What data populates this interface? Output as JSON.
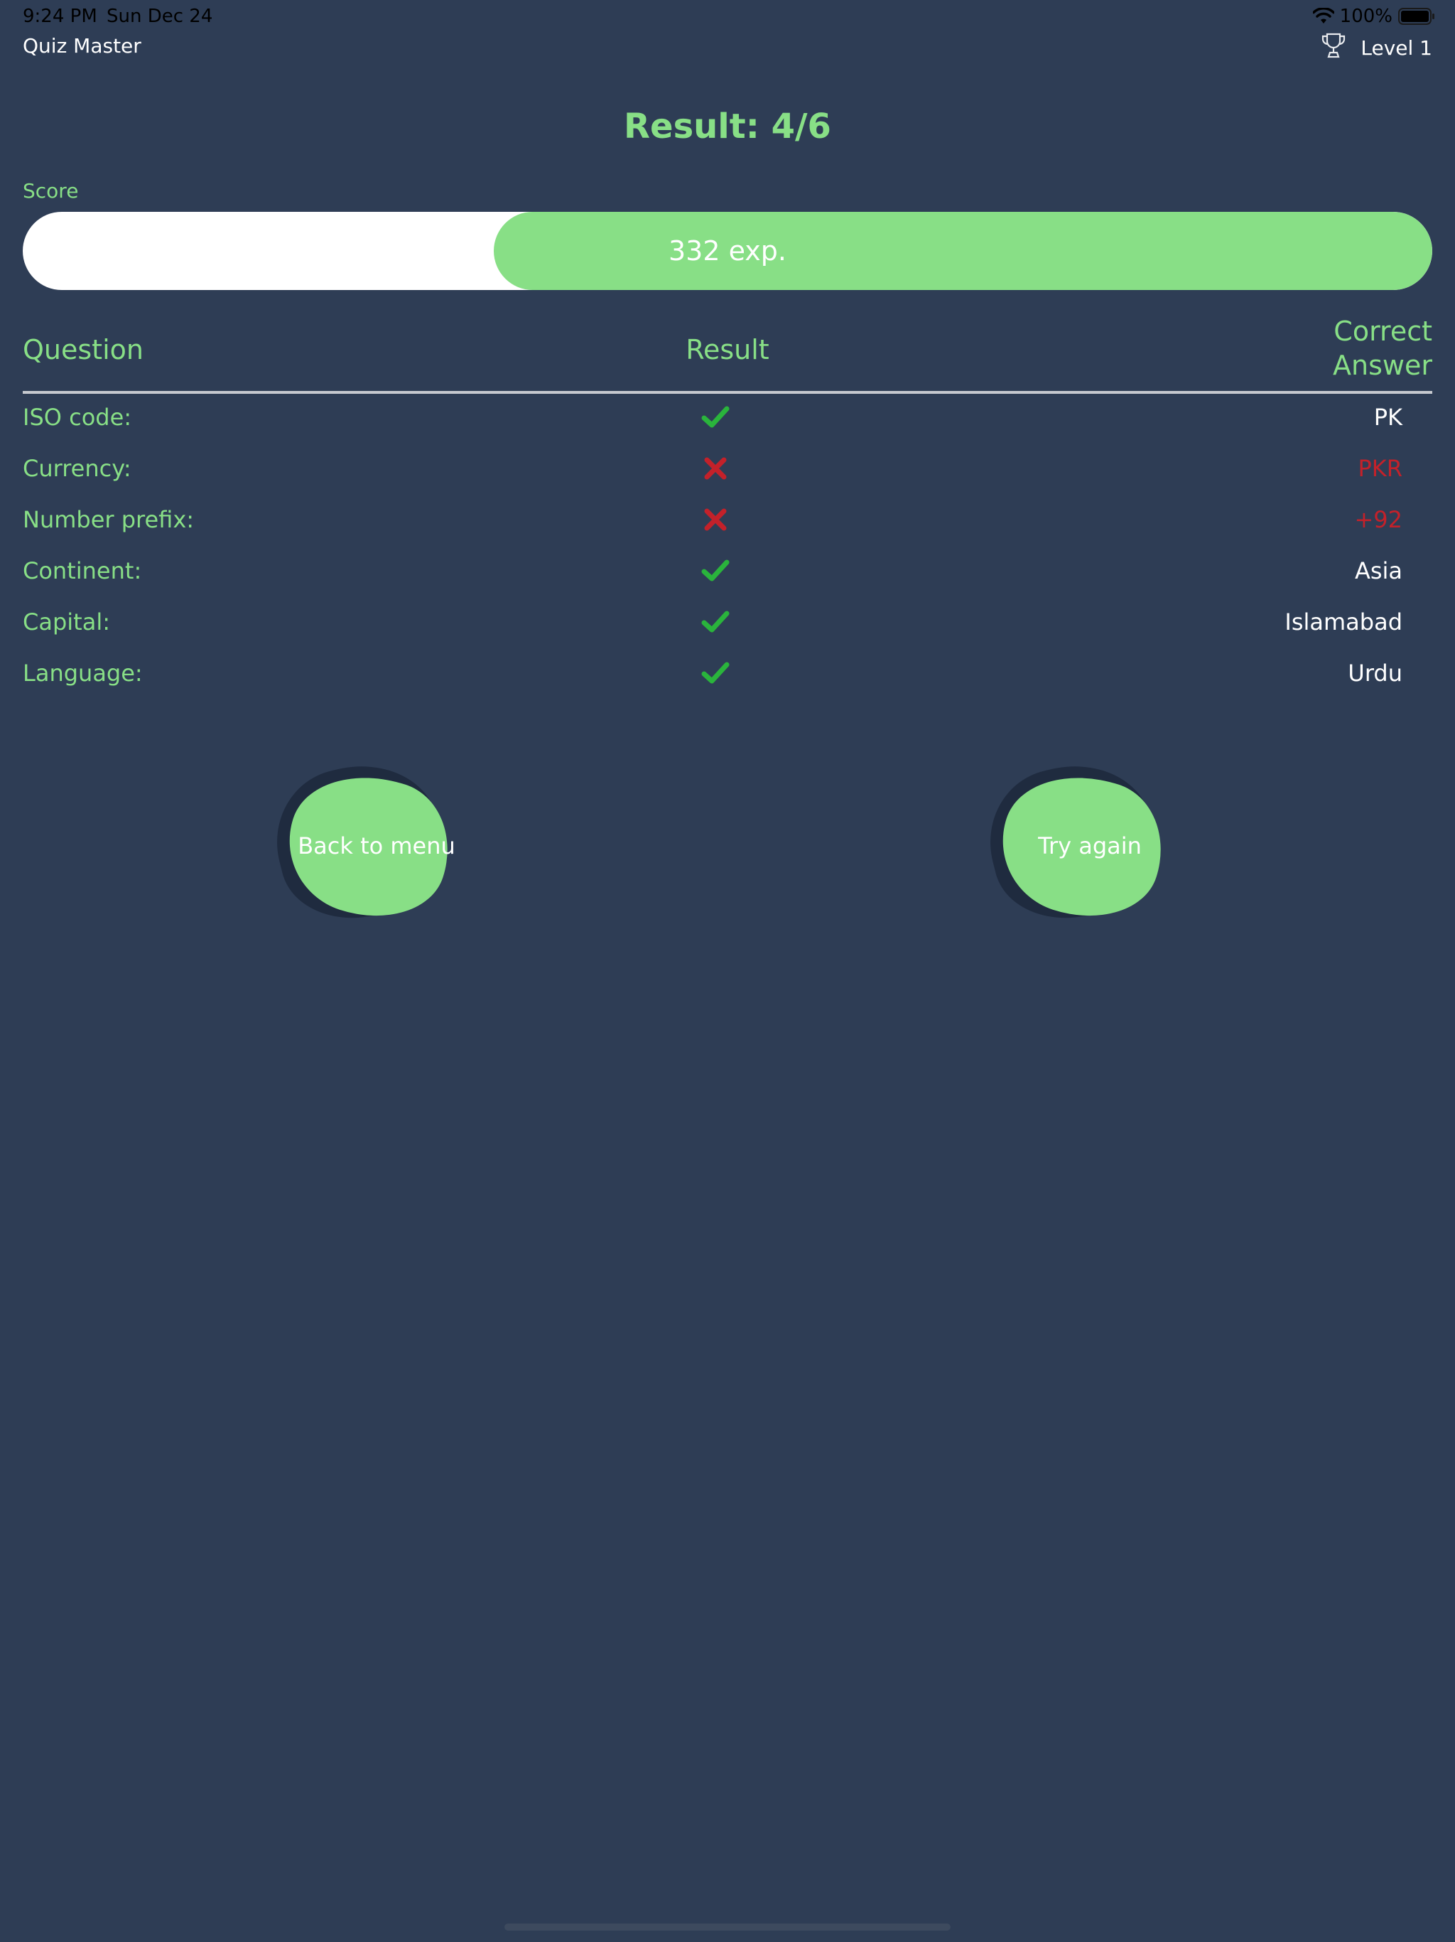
{
  "status_bar": {
    "time": "9:24 PM",
    "date": "Sun Dec 24",
    "battery": "100%"
  },
  "header": {
    "app_title": "Quiz Master",
    "level": "Level 1",
    "level_icon": "trophy-icon"
  },
  "result": {
    "title": "Result: 4/6"
  },
  "score": {
    "label": "Score",
    "value_text": "332 exp.",
    "progress_fraction": 0.666
  },
  "table": {
    "headers": {
      "question": "Question",
      "result": "Result",
      "correct_answer_line1": "Correct",
      "correct_answer_line2": "Answer"
    },
    "rows": [
      {
        "question": "ISO code:",
        "correct": true,
        "answer": "PK"
      },
      {
        "question": "Currency:",
        "correct": false,
        "answer": "PKR"
      },
      {
        "question": "Number prefix:",
        "correct": false,
        "answer": "+92"
      },
      {
        "question": "Continent:",
        "correct": true,
        "answer": "Asia"
      },
      {
        "question": "Capital:",
        "correct": true,
        "answer": "Islamabad"
      },
      {
        "question": "Language:",
        "correct": true,
        "answer": "Urdu"
      }
    ]
  },
  "buttons": {
    "back": "Back to menu",
    "retry": "Try again"
  },
  "colors": {
    "background": "#2e3d55",
    "accent_green": "#88df86",
    "check_green": "#2ab43c",
    "error_red": "#c3212a"
  }
}
